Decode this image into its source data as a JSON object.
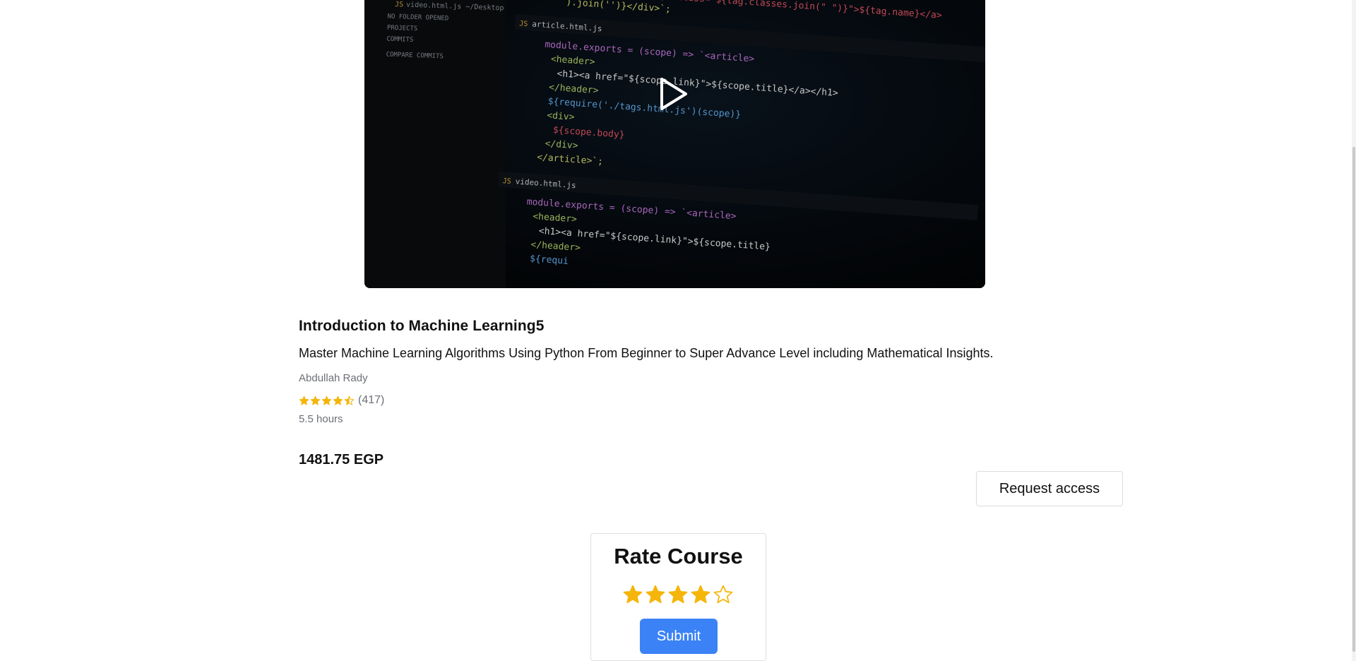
{
  "course": {
    "title": "Introduction to Machine Learning5",
    "subtitle": "Master Machine Learning Algorithms Using Python From Beginner to Super Advance Level including Mathematical Insights.",
    "author": "Abdullah Rady",
    "rating": 4.5,
    "rating_count": "(417)",
    "duration": "5.5 hours",
    "price": "1481.75 EGP"
  },
  "actions": {
    "request_access_label": "Request access"
  },
  "rate_card": {
    "title": "Rate Course",
    "selected_rating": 4,
    "max_rating": 5,
    "submit_label": "Submit"
  },
  "colors": {
    "star": "#f5b50a",
    "primary_button": "#3b82f6"
  },
  "video": {
    "play_icon": "play-icon",
    "thumbnail_code": {
      "sidebar": [
        "video.html.js ~/Desktop",
        "NO FOLDER OPENED",
        "PROJECTS",
        "COMMITS",
        "COMPARE COMMITS"
      ],
      "tab1": "article.html.js",
      "tab2": "video.html.js",
      "lines_top": [
        "a href=\"${tag.link}\" class=\"${tag.classes.join(\" \")}\">${tag.name}</a>",
        "`).join('')}</div>`;"
      ],
      "lines_mid": [
        "module.exports = (scope) => `<article>",
        "<header>",
        "<h1><a href=\"${scope.link}\">${scope.title}</a></h1>",
        "</header>",
        "${require('./tags.html.js')(scope)}",
        "<div>",
        "${scope.body}",
        "</div>",
        "</article>`;"
      ],
      "lines_bot": [
        "module.exports = (scope) => `<article>",
        "<header>",
        "<h1><a href=\"${scope.link}\">${scope.title}",
        "</header>",
        "${requi"
      ]
    }
  }
}
